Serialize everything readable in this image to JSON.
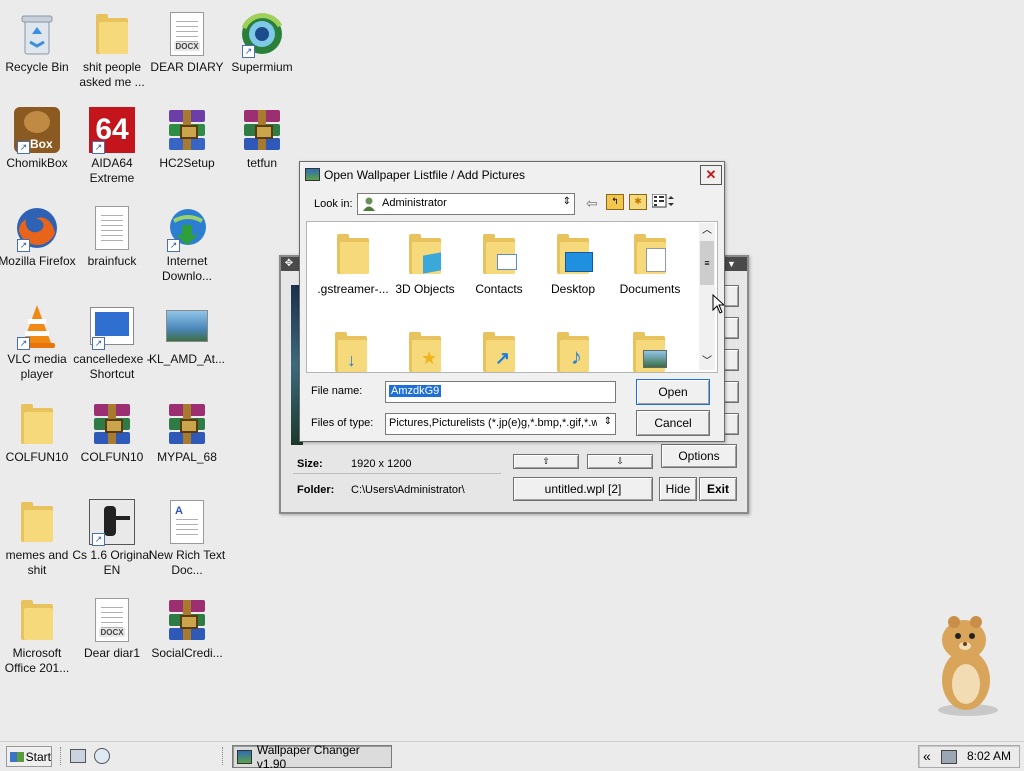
{
  "desktop": {
    "icons": [
      {
        "label": "Recycle Bin"
      },
      {
        "label": "shit people asked me ..."
      },
      {
        "label": "DEAR DIARY"
      },
      {
        "label": "Supermium"
      },
      {
        "label": "ChomikBox"
      },
      {
        "label": "AIDA64 Extreme"
      },
      {
        "label": "HC2Setup"
      },
      {
        "label": "tetfun"
      },
      {
        "label": "Mozilla Firefox"
      },
      {
        "label": "brainfuck"
      },
      {
        "label": "Internet Downlo..."
      },
      {
        "label": "VLC media player"
      },
      {
        "label": "cancelledexe - Shortcut"
      },
      {
        "label": "KL_AMD_At..."
      },
      {
        "label": "COLFUN10"
      },
      {
        "label": "COLFUN10"
      },
      {
        "label": "MYPAL_68"
      },
      {
        "label": "memes and shit"
      },
      {
        "label": "Cs 1.6 Original EN"
      },
      {
        "label": "New Rich Text Doc..."
      },
      {
        "label": "Microsoft Office 201..."
      },
      {
        "label": "Dear diar1"
      },
      {
        "label": "SocialCredi..."
      }
    ],
    "docx_tag": "DOCX",
    "aida_text": "64",
    "chomik_text": "Box"
  },
  "background_app": {
    "size_label": "Size:",
    "size_value": "1920 x 1200",
    "folder_label": "Folder:",
    "folder_value": "C:\\Users\\Administrator\\",
    "options_label": "Options",
    "list_label": "untitled.wpl  [2]",
    "hide_label": "Hide",
    "exit_label": "Exit"
  },
  "dialog": {
    "title": "Open Wallpaper Listfile / Add Pictures",
    "look_in_label": "Look in:",
    "look_in_value": "Administrator",
    "items": [
      {
        "label": ".gstreamer-..."
      },
      {
        "label": "3D Objects"
      },
      {
        "label": "Contacts"
      },
      {
        "label": "Desktop"
      },
      {
        "label": "Documents"
      }
    ],
    "filename_label": "File name:",
    "filename_value": "AmzdkG9",
    "filetype_label": "Files of type:",
    "filetype_value": "Pictures,Picturelists (*.jp(e)g,*.bmp,*.gif,*.wp",
    "open_label": "Open",
    "cancel_label": "Cancel"
  },
  "taskbar": {
    "start_label": "Start",
    "task_label": "Wallpaper Changer v1.90",
    "clock": "8:02 AM",
    "chevron": "«"
  }
}
